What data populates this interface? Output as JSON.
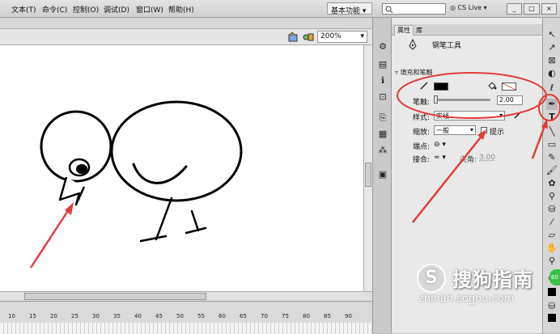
{
  "menu": [
    "文本(T)",
    "命令(C)",
    "控制(O)",
    "调试(D)",
    "窗口(W)",
    "帮助(H)"
  ],
  "workspace_label": "基本功能",
  "cs_live": "CS Live",
  "window_buttons": [
    "_",
    "□",
    "×"
  ],
  "zoom_value": "200%",
  "timeline_ticks": [
    "10",
    "15",
    "20",
    "25",
    "30",
    "35",
    "40",
    "45",
    "50",
    "55",
    "60",
    "65",
    "70",
    "75",
    "80",
    "85",
    "90"
  ],
  "panel": {
    "tabs": [
      "属性",
      "库"
    ],
    "tool_name": "钢笔工具",
    "section_title": "填充和笔触",
    "stroke_label": "笔触:",
    "stroke_value": "2.00",
    "style_label": "样式:",
    "style_value": "实线",
    "scale_label": "缩放:",
    "scale_value": "一般",
    "hint_label": "提示",
    "cap_label": "端点:",
    "join_label": "接合:",
    "miter_label": "尖角:",
    "miter_value": "3.00"
  },
  "colors": {
    "stroke_color": "#000000",
    "fill_color": "none",
    "annotation_red": "#e23b3b"
  },
  "watermark": {
    "logo_letter": "S",
    "main": "搜狗指南",
    "url": "zhinan.sogou.com"
  },
  "badge_text": "60"
}
